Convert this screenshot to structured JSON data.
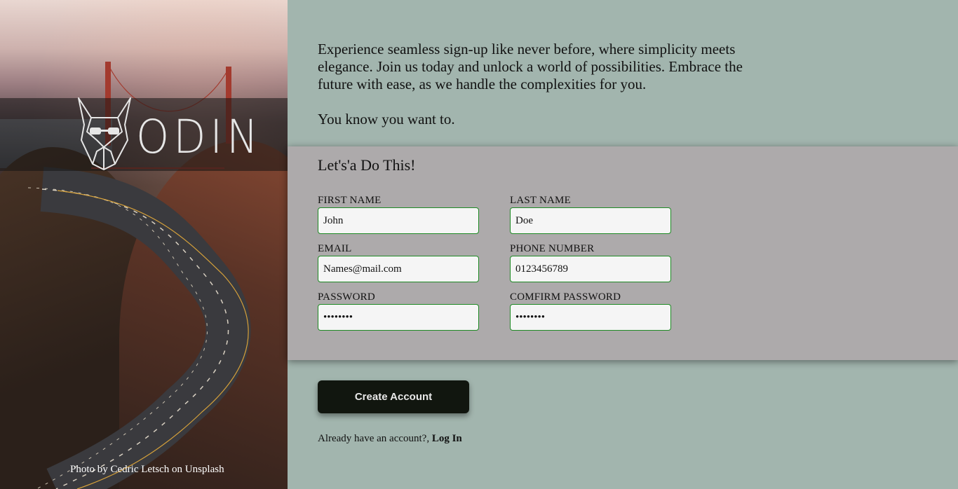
{
  "hero": {
    "logo_text": "ODIN",
    "credit_prefix": "Photo by ",
    "credit_author": "Cedric Letsch",
    "credit_middle": " on ",
    "credit_site": "Unsplash"
  },
  "intro": {
    "paragraph": "Experience seamless sign-up like never before, where simplicity meets elegance. Join us today and unlock a world of possibilities. Embrace the future with ease, as we handle the complexities for you.",
    "tagline": "You know you want to."
  },
  "form": {
    "title": "Let's'a Do This!",
    "first_name": {
      "label": "FIRST NAME",
      "value": "John"
    },
    "last_name": {
      "label": "LAST NAME",
      "value": "Doe"
    },
    "email": {
      "label": "EMAIL",
      "value": "Names@mail.com"
    },
    "phone": {
      "label": "PHONE NUMBER",
      "value": "0123456789"
    },
    "password": {
      "label": "PASSWORD",
      "value": "password"
    },
    "confirm_password": {
      "label": "COMFIRM PASSWORD",
      "value": "password"
    }
  },
  "actions": {
    "create_label": "Create Account",
    "login_prompt": "Already have an account?, ",
    "login_link": "Log In"
  },
  "colors": {
    "page_bg": "#a2b5ae",
    "panel_bg": "#adaaab",
    "input_border": "#1e8a24",
    "button_bg": "#11160f"
  },
  "icons": {
    "logo": "viking-dog-head-icon"
  }
}
